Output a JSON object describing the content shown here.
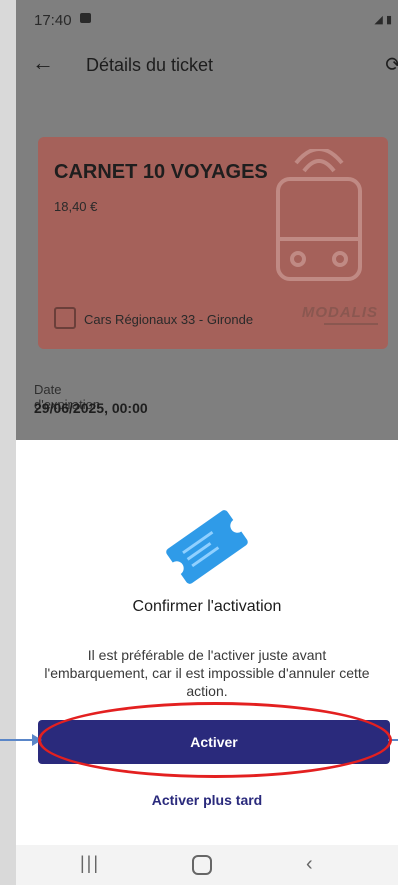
{
  "status_bar": {
    "time": "17:40"
  },
  "header": {
    "title": "Détails du ticket"
  },
  "ticket": {
    "name": "CARNET 10 VOYAGES",
    "price": "18,40 €",
    "operator": "Cars Régionaux 33 - Gironde",
    "brand": "MODALIS",
    "card_color": "#a5615a"
  },
  "expiration": {
    "label": "Date d'expiration",
    "value": "29/06/2025, 00:00"
  },
  "dialog": {
    "title": "Confirmer l'activation",
    "description": "Il est préférable de l'activer juste avant l'embarquement, car il est impossible d'annuler cette action.",
    "activate_label": "Activer",
    "later_label": "Activer plus tard"
  },
  "icons": {
    "back": "arrow-left-icon",
    "refresh": "refresh-icon",
    "ticket": "ticket-icon",
    "bus": "bus-icon",
    "nav_recent": "recent-apps-icon",
    "nav_home": "home-icon",
    "nav_back": "back-nav-icon"
  },
  "colors": {
    "primary": "#2a2a7c",
    "annotation": "#e32020",
    "arrow": "#5a86c8"
  }
}
